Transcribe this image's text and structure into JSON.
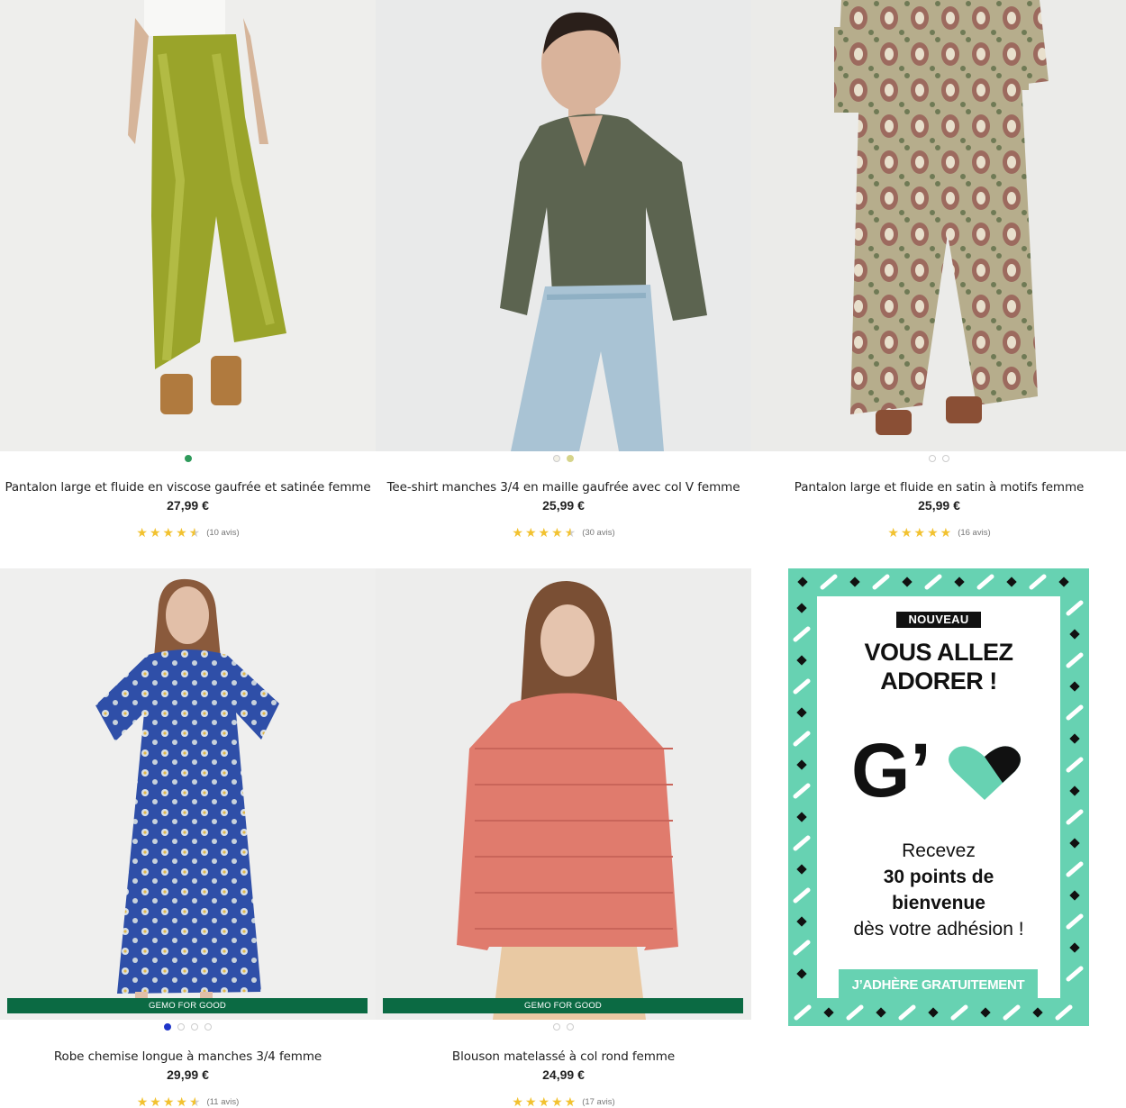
{
  "products": [
    {
      "name": "Pantalon large et fluide en viscose gaufrée et satinée femme",
      "price": "27,99 €",
      "rating": 4.5,
      "reviews": "(10 avis)",
      "swatches": [
        "#2f9a5b"
      ],
      "badge": ""
    },
    {
      "name": "Tee-shirt manches 3/4 en maille gaufrée avec col V femme",
      "price": "25,99 €",
      "rating": 4.5,
      "reviews": "(30 avis)",
      "swatches": [
        "#f3f1e6",
        "#d6d48a"
      ],
      "badge": ""
    },
    {
      "name": "Pantalon large et fluide en satin à motifs femme",
      "price": "25,99 €",
      "rating": 5,
      "reviews": "(16 avis)",
      "swatches": [
        "#ffffff",
        "#ffffff"
      ],
      "badge": ""
    },
    {
      "name": "Robe chemise longue à manches 3/4 femme",
      "price": "29,99 €",
      "rating": 4.5,
      "reviews": "(11 avis)",
      "swatches": [
        "#1f35c9",
        "#ffffff",
        "#ffffff",
        "#ffffff"
      ],
      "badge": "GEMO FOR GOOD"
    },
    {
      "name": "Blouson matelassé à col rond femme",
      "price": "24,99 €",
      "rating": 5,
      "reviews": "(17 avis)",
      "swatches": [
        "#ffffff",
        "#ffffff"
      ],
      "badge": "GEMO FOR GOOD"
    }
  ],
  "promo": {
    "tag": "NOUVEAU",
    "headline_1": "VOUS ALLEZ",
    "headline_2": "ADORER !",
    "logo_text": "G’",
    "line_1": "Recevez",
    "line_2": "30 points de",
    "line_3": "bienvenue",
    "line_4": "dès votre adhésion !",
    "cta": "J’ADHÈRE GRATUITEMENT",
    "colors": {
      "mint": "#67d2b2",
      "dark": "#111111"
    }
  },
  "colors": {
    "star": "#f2c230",
    "badge_bg": "#0b6a43"
  }
}
